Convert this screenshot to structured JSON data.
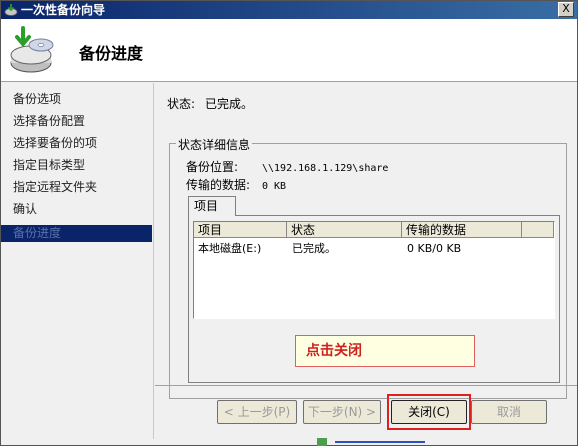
{
  "window": {
    "title": "一次性备份向导",
    "close_label": "X"
  },
  "header": {
    "page_title": "备份进度"
  },
  "nav": {
    "items": [
      {
        "label": "备份选项"
      },
      {
        "label": "选择备份配置"
      },
      {
        "label": "选择要备份的项"
      },
      {
        "label": "指定目标类型"
      },
      {
        "label": "指定远程文件夹"
      },
      {
        "label": "确认"
      },
      {
        "label": "备份进度"
      }
    ],
    "active_index": 6
  },
  "status": {
    "label": "状态:",
    "value": "已完成。"
  },
  "details": {
    "legend": "状态详细信息",
    "location_label": "备份位置:",
    "location_value": "\\\\192.168.1.129\\share",
    "transferred_label": "传输的数据:",
    "transferred_value": "0 KB",
    "tab_label": "项目",
    "columns": [
      "项目",
      "状态",
      "传输的数据"
    ],
    "rows": [
      {
        "item": "本地磁盘(E:)",
        "status": "已完成。",
        "data": "0 KB/0 KB"
      }
    ]
  },
  "callout": {
    "text": "点击关闭"
  },
  "buttons": {
    "prev": "< 上一步(P)",
    "next": "下一步(N) >",
    "close": "关闭(C)",
    "cancel": "取消"
  },
  "colors": {
    "titlebar": "#0a246a",
    "nav_active": "#0a246a",
    "callout_text": "#d02020",
    "highlight": "#e02020"
  }
}
